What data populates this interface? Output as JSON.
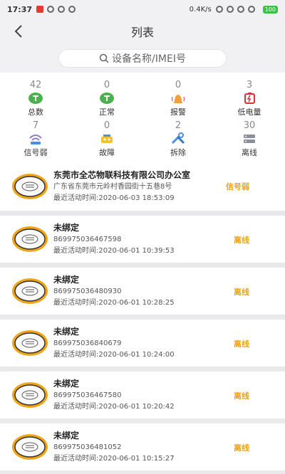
{
  "statusbar": {
    "time": "17:37",
    "net_speed": "0.4K/s",
    "battery": "100"
  },
  "navbar": {
    "title": "列表"
  },
  "search": {
    "placeholder": "设备名称/IMEI号"
  },
  "colors": {
    "green": "#4caf50",
    "orange": "#e8a418",
    "red": "#d9313b",
    "blue": "#4a90e2",
    "purple": "#8e7cc3",
    "gray": "#8a8f99"
  },
  "stats": [
    {
      "count": "42",
      "label": "总数",
      "icon": "device-total-icon"
    },
    {
      "count": "0",
      "label": "正常",
      "icon": "device-normal-icon"
    },
    {
      "count": "0",
      "label": "报警",
      "icon": "alarm-bell-icon"
    },
    {
      "count": "3",
      "label": "低电量",
      "icon": "low-battery-icon"
    },
    {
      "count": "7",
      "label": "信号弱",
      "icon": "weak-signal-icon"
    },
    {
      "count": "0",
      "label": "故障",
      "icon": "fault-icon"
    },
    {
      "count": "2",
      "label": "拆除",
      "icon": "removed-wrench-icon"
    },
    {
      "count": "30",
      "label": "离线",
      "icon": "offline-icon"
    }
  ],
  "devices": [
    {
      "name": "东莞市全芯物联科技有限公司办公室",
      "line2": "广东省东莞市元岭村香园街十五巷8号",
      "last_active": "最近活动时间:2020-06-03 18:53:09",
      "status": "信号弱"
    },
    {
      "name": "未绑定",
      "line2": "869975036467598",
      "last_active": "最近活动时间:2020-06-01 10:39:53",
      "status": "离线"
    },
    {
      "name": "未绑定",
      "line2": "869975036480930",
      "last_active": "最近活动时间:2020-06-01 10:28:25",
      "status": "离线"
    },
    {
      "name": "未绑定",
      "line2": "869975036840679",
      "last_active": "最近活动时间:2020-06-01 10:24:00",
      "status": "离线"
    },
    {
      "name": "未绑定",
      "line2": "869975036467580",
      "last_active": "最近活动时间:2020-06-01 10:20:42",
      "status": "离线"
    },
    {
      "name": "未绑定",
      "line2": "869975036481052",
      "last_active": "最近活动时间:2020-06-01 10:15:27",
      "status": "离线"
    }
  ]
}
